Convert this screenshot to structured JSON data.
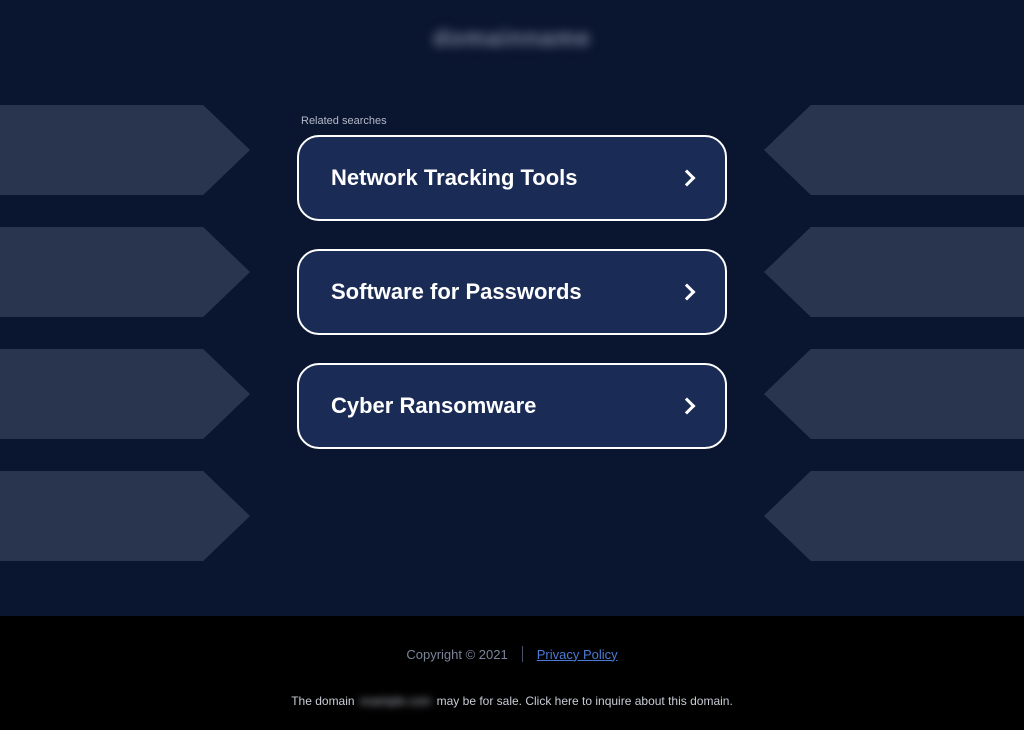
{
  "header": {
    "logo_text": "domainname"
  },
  "search": {
    "related_label": "Related searches",
    "items": [
      {
        "label": "Network Tracking Tools"
      },
      {
        "label": "Software for Passwords"
      },
      {
        "label": "Cyber Ransomware"
      }
    ]
  },
  "footer": {
    "copyright": "Copyright © 2021",
    "privacy_link": "Privacy Policy",
    "domain_prefix": "The domain",
    "domain_blur": "example.com",
    "domain_suffix": "may be for sale. Click here to inquire about this domain."
  }
}
